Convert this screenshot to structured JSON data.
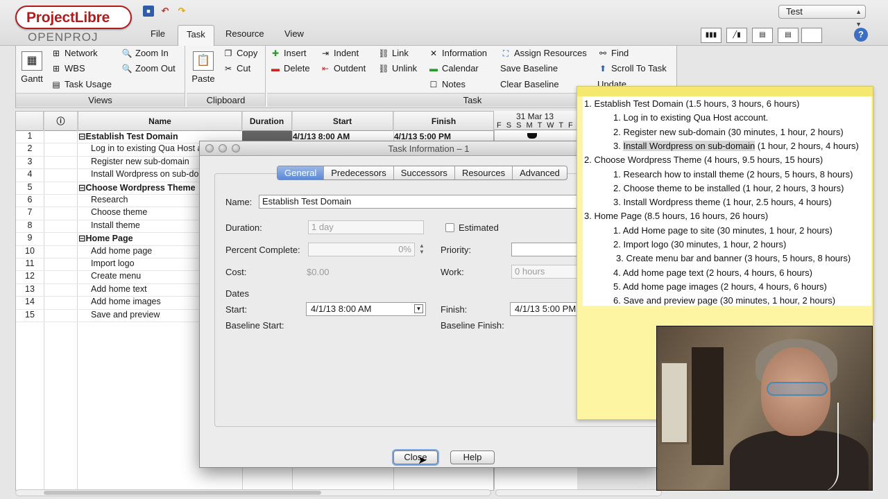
{
  "app": {
    "logo_main": "ProjectLibre",
    "logo_tm": "TM",
    "logo_sub": "OPENPROJ"
  },
  "menu": [
    "File",
    "Task",
    "Resource",
    "View"
  ],
  "project_select": "Test",
  "ribbon": {
    "views": {
      "label": "Views",
      "gantt": "Gantt",
      "items": [
        "Network",
        "WBS",
        "Task Usage"
      ],
      "zoom_in": "Zoom In",
      "zoom_out": "Zoom Out"
    },
    "clipboard": {
      "label": "Clipboard",
      "paste": "Paste",
      "copy": "Copy",
      "cut": "Cut"
    },
    "task": {
      "label": "Task",
      "insert": "Insert",
      "delete": "Delete",
      "indent": "Indent",
      "outdent": "Outdent",
      "link": "Link",
      "unlink": "Unlink",
      "information": "Information",
      "calendar": "Calendar",
      "notes": "Notes",
      "assign_resources": "Assign Resources",
      "save_baseline": "Save Baseline",
      "clear_baseline": "Clear Baseline",
      "find": "Find",
      "scroll_to_task": "Scroll To Task",
      "update": "Update"
    }
  },
  "grid": {
    "headers": {
      "name": "Name",
      "duration": "Duration",
      "start": "Start",
      "finish": "Finish"
    },
    "first_start": "4/1/13 8:00 AM",
    "first_finish": "4/1/13 5:00 PM",
    "timeline_date": "31 Mar 13",
    "timeline_days": "F S S M T W T F",
    "rows": [
      {
        "id": "1",
        "name": "⊟Establish Test Domain"
      },
      {
        "id": "2",
        "name": "Log in to existing Qua Host a"
      },
      {
        "id": "3",
        "name": "Register new sub-domain"
      },
      {
        "id": "4",
        "name": "Install Wordpress on sub-do"
      },
      {
        "id": "5",
        "name": "⊟Choose Wordpress Theme"
      },
      {
        "id": "6",
        "name": "Research"
      },
      {
        "id": "7",
        "name": "Choose theme"
      },
      {
        "id": "8",
        "name": "Install theme"
      },
      {
        "id": "9",
        "name": "⊟Home Page"
      },
      {
        "id": "10",
        "name": "Add home page"
      },
      {
        "id": "11",
        "name": "Import logo"
      },
      {
        "id": "12",
        "name": "Create menu"
      },
      {
        "id": "13",
        "name": "Add home text"
      },
      {
        "id": "14",
        "name": "Add home images"
      },
      {
        "id": "15",
        "name": "Save and preview"
      }
    ]
  },
  "dialog": {
    "title": "Task Information – 1",
    "tabs": [
      "General",
      "Predecessors",
      "Successors",
      "Resources",
      "Advanced"
    ],
    "name_label": "Name:",
    "name_value": "Establish Test Domain",
    "duration_label": "Duration:",
    "duration_value": "1 day",
    "estimated_label": "Estimated",
    "percent_label": "Percent Complete:",
    "percent_value": "0%",
    "priority_label": "Priority:",
    "cost_label": "Cost:",
    "cost_value": "$0.00",
    "work_label": "Work:",
    "work_value": "0 hours",
    "dates_label": "Dates",
    "start_label": "Start:",
    "start_value": "4/1/13 8:00 AM",
    "finish_label": "Finish:",
    "finish_value": "4/1/13 5:00 PM",
    "baseline_start_label": "Baseline Start:",
    "baseline_finish_label": "Baseline Finish:",
    "close": "Close",
    "help": "Help"
  },
  "note": {
    "lines": [
      {
        "indent": 0,
        "text": "1. Establish Test Domain (1.5 hours, 3 hours, 6 hours)"
      },
      {
        "indent": 1,
        "text": "1. Log in to existing Qua Host account."
      },
      {
        "indent": 1,
        "text": "2. Register new sub-domain (30 minutes, 1 hour, 2 hours)"
      },
      {
        "indent": 1,
        "text": "3. ",
        "highlight": "Install Wordpress on sub-domain",
        "rest": " (1 hour, 2 hours, 4 hours)"
      },
      {
        "indent": 0,
        "text": "2. Choose Wordpress Theme (4 hours, 9.5 hours, 15 hours)"
      },
      {
        "indent": 1,
        "text": "1. Research how to install theme (2 hours, 5 hours, 8 hours)"
      },
      {
        "indent": 1,
        "text": "2. Choose theme to be installed (1 hour, 2 hours, 3 hours)"
      },
      {
        "indent": 1,
        "text": "3. Install Wordpress theme (1 hour, 2.5 hours, 4 hours)"
      },
      {
        "indent": 0,
        "text": "3. Home Page (8.5 hours, 16 hours, 26 hours)"
      },
      {
        "indent": 1,
        "text": "1. Add Home page to site (30 minutes, 1 hour, 2 hours)"
      },
      {
        "indent": 1,
        "text": "2. Import logo (30 minutes, 1 hour, 2 hours)"
      },
      {
        "indent": 2,
        "text": "3. Create menu bar and banner (3 hours, 5 hours, 8 hours)"
      },
      {
        "indent": 1,
        "text": "4. Add home page text (2 hours, 4 hours, 6 hours)"
      },
      {
        "indent": 1,
        "text": "5. Add home page images (2 hours, 4 hours, 6 hours)"
      },
      {
        "indent": 1,
        "text": "6. Save and preview page (30 minutes, 1 hour, 2 hours)"
      }
    ]
  },
  "colors": {
    "logo_red": "#b01c1c",
    "tab_active": "#5a8ad8",
    "note_yellow": "#fdf5a2"
  }
}
